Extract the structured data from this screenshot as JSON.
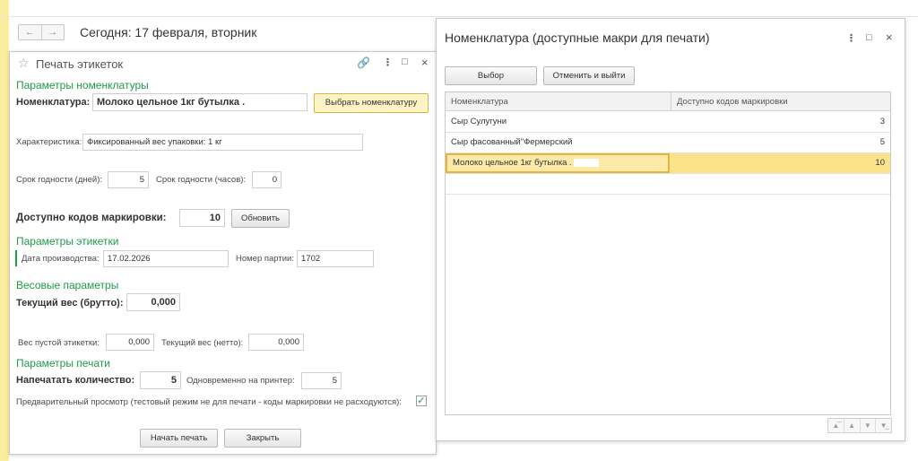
{
  "topbar": {
    "back_icon": "arrow-left-icon",
    "forward_icon": "arrow-right-icon",
    "today_text": "Сегодня: 17 февраля, вторник"
  },
  "print_labels": {
    "title": "Печать этикеток",
    "sections": {
      "nomenclature": "Параметры номенклатуры",
      "label": "Параметры этикетки",
      "weight": "Весовые параметры",
      "print": "Параметры печати"
    },
    "nomenclature_label": "Номенклатура:",
    "nomenclature_value": "Молоко цельное 1кг бутылка .",
    "select_button": "Выбрать номенклатуру",
    "characteristic_label": "Характеристика:",
    "characteristic_value": "Фиксированный вес упаковки: 1 кг",
    "shelf_days_label": "Срок годности (дней):",
    "shelf_days_value": "5",
    "shelf_hours_label": "Срок годности (часов):",
    "shelf_hours_value": "0",
    "available_codes_label": "Доступно кодов маркировки:",
    "available_codes_value": "10",
    "refresh_button": "Обновить",
    "production_date_label": "Дата производства:",
    "production_date_value": "17.02.2026",
    "batch_label": "Номер партии:",
    "batch_value": "1702",
    "gross_weight_label": "Текущий вес (брутто):",
    "gross_weight_value": "0,000",
    "empty_label_weight_label": "Вес пустой этикетки:",
    "empty_label_weight_value": "0,000",
    "net_weight_label": "Текущий вес (нетто):",
    "net_weight_value": "0,000",
    "print_qty_label": "Напечатать количество:",
    "print_qty_value": "5",
    "simultaneous_label": "Одновременно на принтер:",
    "simultaneous_value": "5",
    "preview_label": "Предварительный просмотр (тестовый режим не для печати - коды маркировки не расходуются):",
    "preview_checked": true,
    "start_button": "Начать печать",
    "close_button": "Закрыть"
  },
  "nomenclature_window": {
    "title": "Номенклатура (доступные макри для печати)",
    "select_button": "Выбор",
    "cancel_button": "Отменить и выйти",
    "columns": [
      "Номенклатура",
      "Доступно кодов маркировки"
    ],
    "rows": [
      {
        "name": "Сыр Сулугуни",
        "count": "3"
      },
      {
        "name": "Сыр фасованный\"Фермерский",
        "count": "5"
      },
      {
        "name": "Молоко цельное 1кг бутылка .",
        "count": "10"
      }
    ],
    "selected_row": 2
  },
  "colors": {
    "accent_green": "#1e9a48",
    "highlight_yellow": "#fbe38c",
    "strip_yellow": "#fbed9e"
  }
}
